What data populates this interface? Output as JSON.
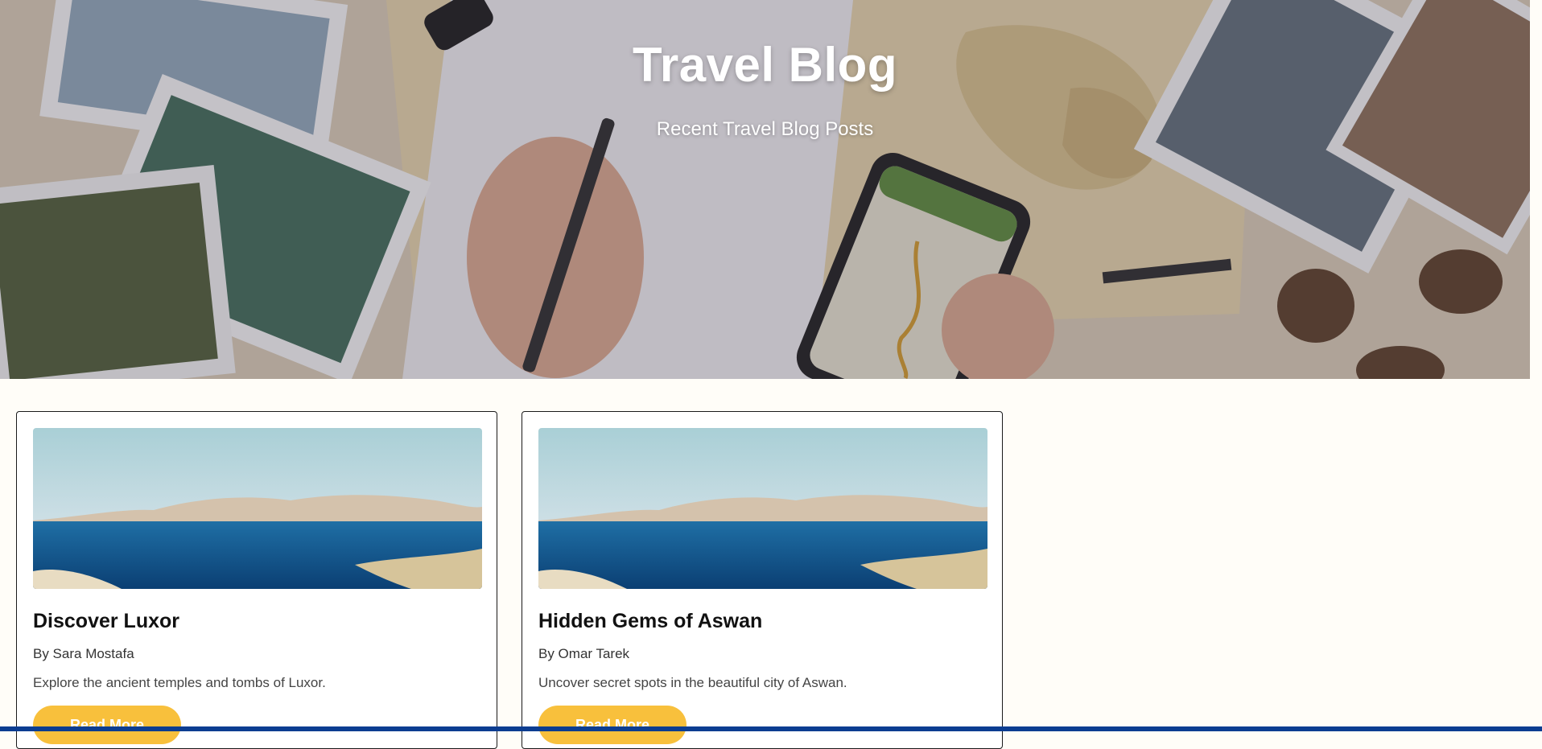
{
  "hero": {
    "title": "Travel Blog",
    "subtitle": "Recent Travel Blog Posts",
    "background_image": "travel-desk-map-photos"
  },
  "posts": [
    {
      "image": "lake-and-mountains-photo",
      "title": "Discover Luxor",
      "author": "By Sara Mostafa",
      "excerpt": "Explore the ancient temples and tombs of Luxor.",
      "button_label": "Read More"
    },
    {
      "image": "lake-and-mountains-photo",
      "title": "Hidden Gems of Aswan",
      "author": "By Omar Tarek",
      "excerpt": "Uncover secret spots in the beautiful city of Aswan.",
      "button_label": "Read More"
    }
  ],
  "colors": {
    "accent": "#f8c03c",
    "page_background": "#fffdf8",
    "footer_bar": "#0b3d91"
  }
}
